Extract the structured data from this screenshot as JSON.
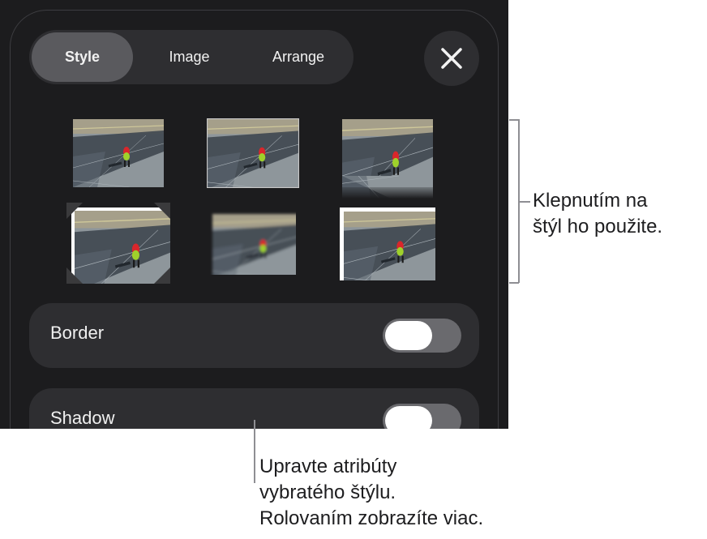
{
  "tabs": [
    {
      "label": "Style",
      "active": true
    },
    {
      "label": "Image",
      "active": false
    },
    {
      "label": "Arrange",
      "active": false
    }
  ],
  "close_icon": "xmark-icon",
  "style_presets": [
    "plain",
    "thin-gray-border",
    "reflection",
    "photo-corners",
    "soft-edges",
    "white-frame"
  ],
  "rows": {
    "border": {
      "label": "Border",
      "on": false
    },
    "shadow": {
      "label": "Shadow",
      "on": false
    }
  },
  "callouts": {
    "right": {
      "line1": "Klepnutím na",
      "line2": "štýl ho použite."
    },
    "bottom": {
      "line1": "Upravte atribúty",
      "line2": "vybratého štýlu.",
      "line3": "Rolovaním zobrazíte viac."
    }
  },
  "colors": {
    "panel": "#1c1c1e",
    "control": "#2e2e31",
    "active_tab": "#5a5a5e",
    "toggle_off": "#6a6a6e"
  }
}
